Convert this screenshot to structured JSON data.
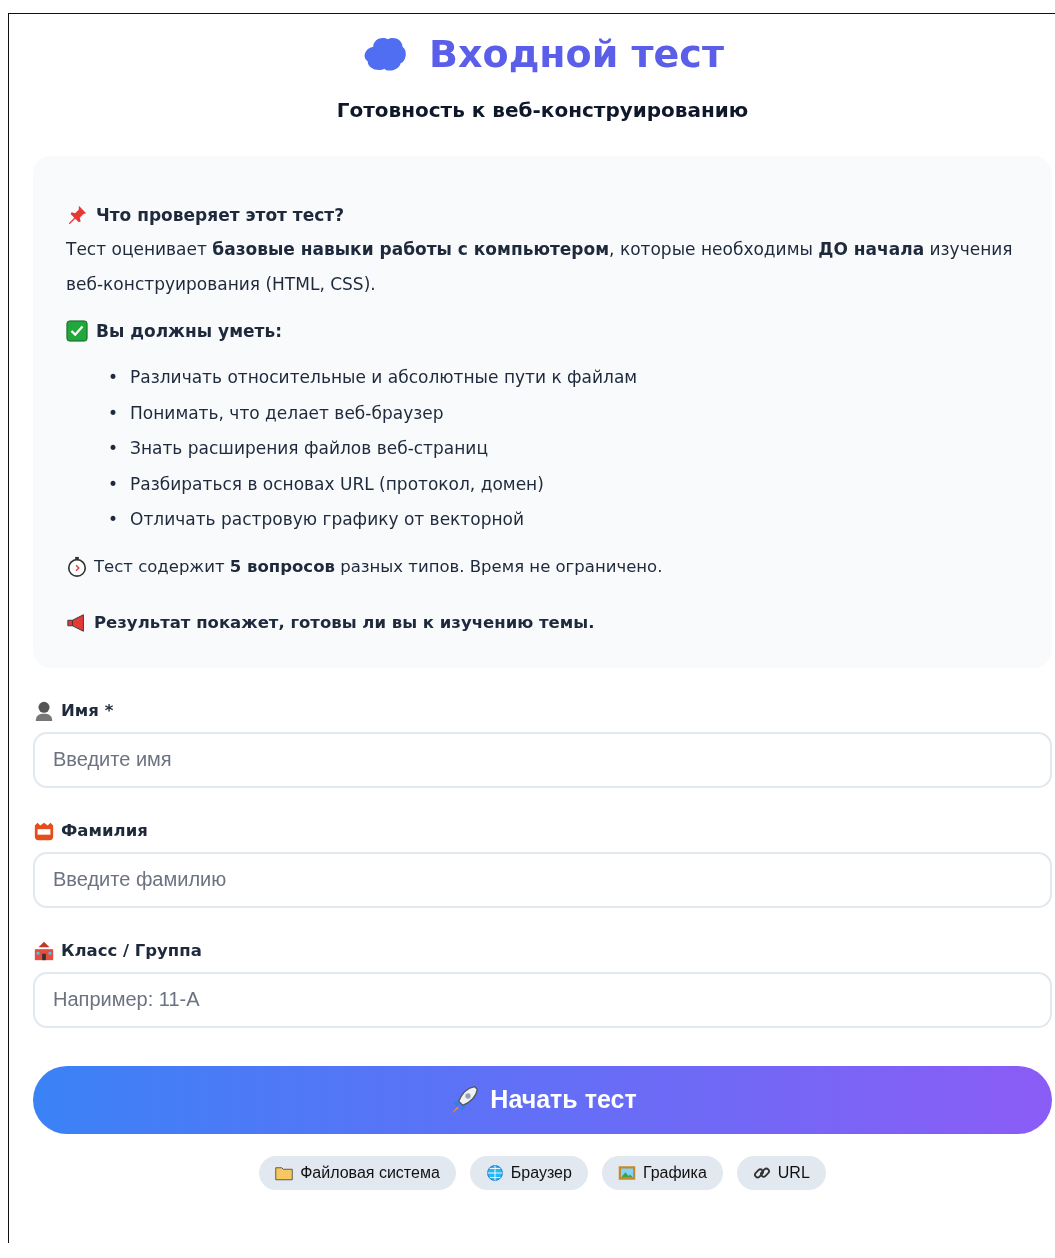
{
  "title": "Входной тест",
  "subtitle": "Готовность к веб-конструированию",
  "info": {
    "heading": "Что проверяет этот тест?",
    "intro": "Тест оценивает **базовые навыки работы с компьютером**, которые необходимы **ДО начала** изучения веб-конструирования (HTML, CSS).",
    "skills_heading": "Вы должны уметь:",
    "skills": [
      {
        "marker": "•",
        "text": "Различать относительные и абсолютные пути к файлам"
      },
      {
        "marker": "•",
        "text": "Понимать, что делает веб-браузер"
      },
      {
        "marker": "•",
        "text": "Знать расширения файлов веб-страниц"
      },
      {
        "marker": "•",
        "text": "Разбираться в основах URL (протокол, домен)"
      },
      {
        "marker": "•",
        "text": "Отличать растровую графику от векторной"
      }
    ],
    "note": "Тест содержит **5 вопросов** разных типов. Время не ограничено.",
    "result": "Результат покажет, готовы ли вы к изучению темы."
  },
  "fields": [
    {
      "kind": "person",
      "label": "Имя *",
      "placeholder": "Введите имя"
    },
    {
      "kind": "badge",
      "label": "Фамилия",
      "placeholder": "Введите фамилию"
    },
    {
      "kind": "school",
      "label": "Класс / Группа",
      "placeholder": "Например: 11-А"
    }
  ],
  "start_button": "Начать тест",
  "tags": [
    {
      "kind": "folder",
      "label": "Файловая система"
    },
    {
      "kind": "globe",
      "label": "Браузер"
    },
    {
      "kind": "image",
      "label": "Графика"
    },
    {
      "kind": "link",
      "label": "URL"
    }
  ]
}
